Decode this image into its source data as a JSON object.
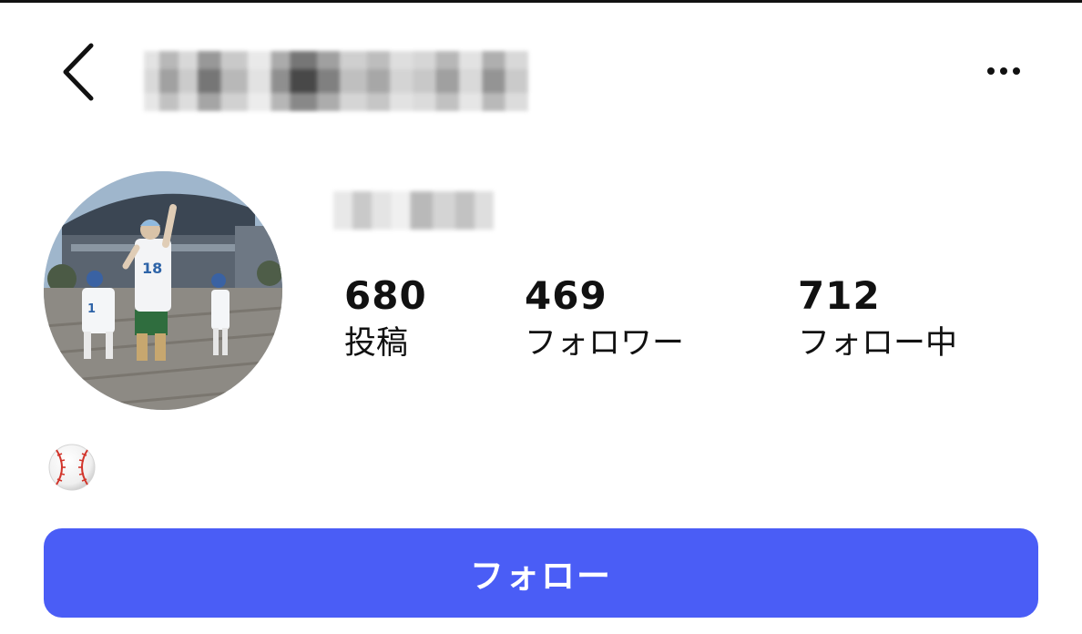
{
  "header": {
    "back_icon": "chevron-left-icon",
    "more_icon": "ellipsis-horizontal-icon"
  },
  "profile": {
    "avatar_icon": "profile-photo-baseball-stadium",
    "bio_icon": "baseball-emoji"
  },
  "stats": [
    {
      "value": "680",
      "label": "投稿"
    },
    {
      "value": "469",
      "label": "フォロワー"
    },
    {
      "value": "712",
      "label": "フォロー中"
    }
  ],
  "actions": {
    "follow_label": "フォロー",
    "follow_color": "#4a5df6"
  }
}
